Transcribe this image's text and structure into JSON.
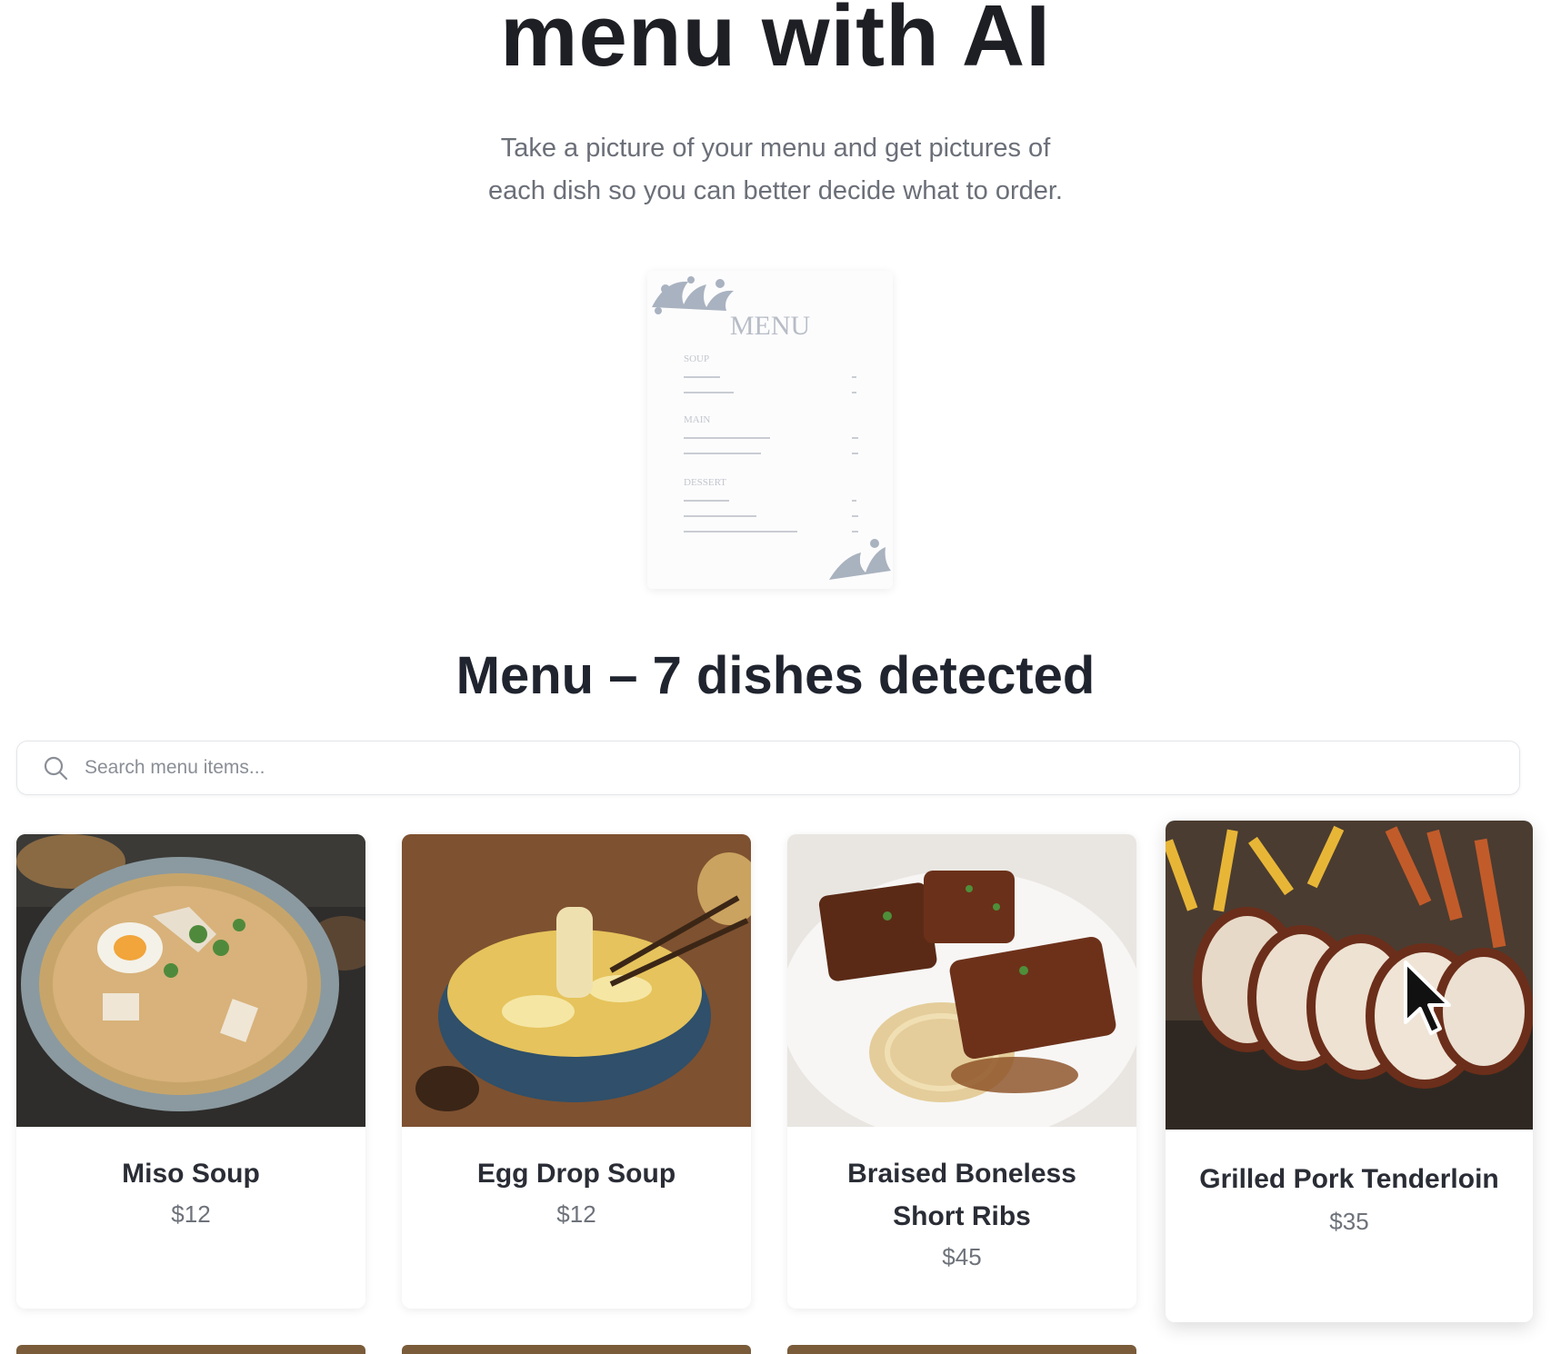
{
  "hero": {
    "title": "menu with AI",
    "subtitle_line1": "Take a picture of your menu and get pictures of",
    "subtitle_line2": "each dish so you can better decide what to order."
  },
  "menu_preview": {
    "heading": "MENU",
    "sections": [
      "SOUP",
      "MAIN",
      "DESSERT"
    ]
  },
  "results": {
    "title": "Menu – 7 dishes detected"
  },
  "search": {
    "placeholder": "Search menu items..."
  },
  "dishes": [
    {
      "name": "Miso Soup",
      "price": "$12"
    },
    {
      "name": "Egg Drop Soup",
      "price": "$12"
    },
    {
      "name": "Braised Boneless Short Ribs",
      "price": "$45"
    },
    {
      "name": "Grilled Pork Tenderloin",
      "price": "$35"
    }
  ],
  "colors": {
    "text_dark": "#1e1f24",
    "text_muted": "#6b6f78",
    "border": "#e4e6ea"
  }
}
